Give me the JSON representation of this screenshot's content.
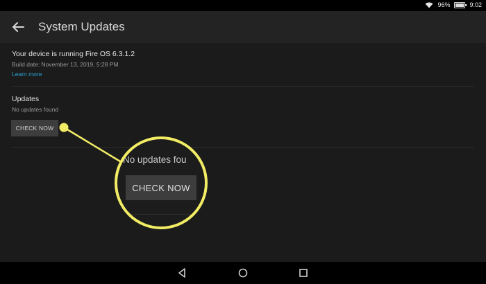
{
  "status": {
    "battery": "96%",
    "time": "9:02",
    "battery_level": 0.96
  },
  "header": {
    "title": "System Updates"
  },
  "device": {
    "running_text": "Your device is running Fire OS 6.3.1.2",
    "build_date": "Build date: November 13, 2019, 5:28 PM",
    "learn_more": "Learn more"
  },
  "updates": {
    "heading": "Updates",
    "status": "No updates found",
    "check_button": "CHECK NOW"
  },
  "magnified": {
    "status_text": "No updates fou",
    "check_button": "CHECK NOW"
  },
  "colors": {
    "callout": "#f2ec65",
    "link": "#2aa7d8",
    "background": "#1b1b1b"
  },
  "icons": {
    "back": "arrow-left-icon",
    "wifi": "wifi-icon",
    "battery": "battery-icon",
    "nav_back": "triangle-back-icon",
    "nav_home": "circle-home-icon",
    "nav_recents": "square-recents-icon"
  }
}
